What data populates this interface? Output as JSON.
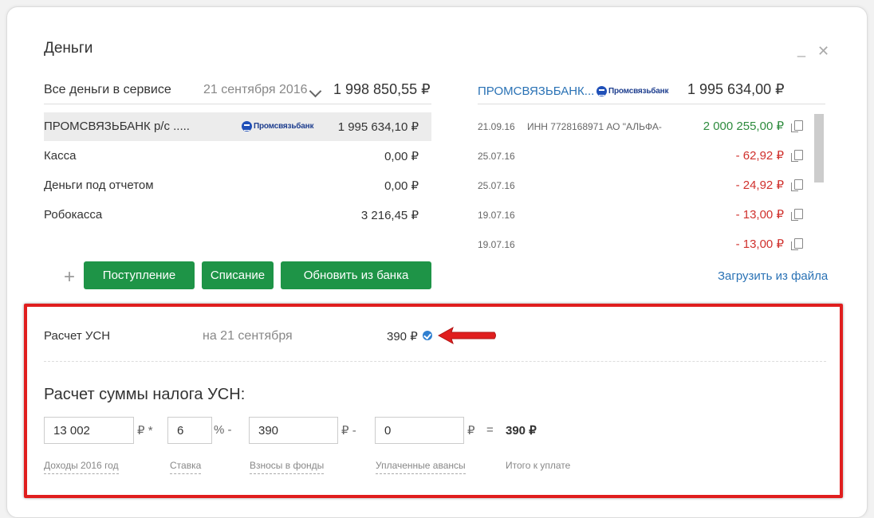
{
  "header": {
    "title": "Деньги",
    "minimize": "_",
    "close": "✕"
  },
  "summary": {
    "label": "Все деньги в сервисе",
    "date": "21 сентября 2016",
    "total": "1 998 850,55 ₽"
  },
  "accounts": [
    {
      "name": "ПРОМСВЯЗЬБАНК р/с .....",
      "logo": "Промсвязьбанк",
      "value": "1 995 634,10 ₽"
    },
    {
      "name": "Касса",
      "value": "0,00 ₽"
    },
    {
      "name": "Деньги под отчетом",
      "value": "0,00 ₽"
    },
    {
      "name": "Робокасса",
      "value": "3 216,45 ₽"
    }
  ],
  "bank": {
    "name": "ПРОМСВЯЗЬБАНК...",
    "logo": "Промсвязьбанк",
    "balance": "1 995 634,00 ₽"
  },
  "transactions": [
    {
      "date": "21.09.16",
      "desc": "ИНН 7728168971 АО \"АЛЬФА-",
      "amount": "2 000 255,00 ₽",
      "type": "pos"
    },
    {
      "date": "25.07.16",
      "desc": "",
      "amount": "- 62,92 ₽",
      "type": "neg"
    },
    {
      "date": "25.07.16",
      "desc": "",
      "amount": "- 24,92 ₽",
      "type": "neg"
    },
    {
      "date": "19.07.16",
      "desc": "",
      "amount": "- 13,00 ₽",
      "type": "neg"
    },
    {
      "date": "19.07.16",
      "desc": "",
      "amount": "- 13,00 ₽",
      "type": "neg"
    }
  ],
  "actions": {
    "plus": "+",
    "income": "Поступление",
    "expense": "Списание",
    "refresh": "Обновить из банка",
    "upload": "Загрузить из файла"
  },
  "usn": {
    "label": "Расчет УСН",
    "date": "на 21 сентября",
    "value": "390 ₽",
    "calc_title": "Расчет суммы налога УСН:",
    "income": "13 002",
    "income_unit": "₽ *",
    "rate": "6",
    "rate_unit": "% -",
    "contrib": "390",
    "contrib_unit": "₽ -",
    "advances": "0",
    "advances_unit": "₽",
    "equals": "=",
    "result": "390 ₽",
    "income_caption": "Доходы 2016 год",
    "rate_caption": "Ставка",
    "contrib_caption": "Взносы в фонды",
    "advances_caption": "Уплаченные авансы",
    "result_caption": "Итого к уплате"
  },
  "colors": {
    "accent_green": "#1e9447",
    "link_blue": "#2a72b5",
    "positive": "#2e8b3e",
    "negative": "#d0312d",
    "highlight_red": "#e01e1e"
  },
  "icons": [
    "chevron-down-icon",
    "copy-icon",
    "check-circle-icon",
    "red-arrow-icon",
    "bank-logo-icon"
  ]
}
